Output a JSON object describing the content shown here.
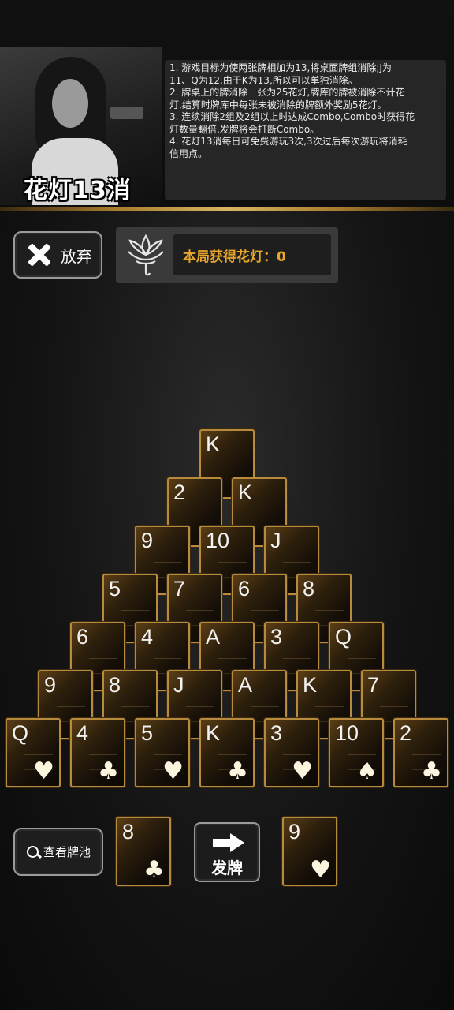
{
  "header": {
    "title": "花灯13消",
    "rules": [
      "1. 游戏目标为使两张牌相加为13,将桌面牌组消除;J为",
      "11、Q为12,由于K为13,所以可以单独消除。",
      "2. 牌桌上的牌消除一张为25花灯,牌库的牌被消除不计花",
      "灯,结算时牌库中每张未被消除的牌额外奖励5花灯。",
      "3. 连续消除2组及2组以上时达成Combo,Combo时获得花",
      "灯数量翻倍,发牌将会打断Combo。",
      "4. 花灯13消每日可免费游玩3次,3次过后每次游玩将消耗",
      "信用点。"
    ]
  },
  "toolbar": {
    "quit_label": "放弃",
    "score_label": "本局获得花灯：0"
  },
  "pyramid": {
    "rows": [
      [
        {
          "v": "K",
          "s": ""
        }
      ],
      [
        {
          "v": "2",
          "s": ""
        },
        {
          "v": "K",
          "s": ""
        }
      ],
      [
        {
          "v": "9",
          "s": ""
        },
        {
          "v": "10",
          "s": ""
        },
        {
          "v": "J",
          "s": ""
        }
      ],
      [
        {
          "v": "5",
          "s": ""
        },
        {
          "v": "7",
          "s": ""
        },
        {
          "v": "6",
          "s": ""
        },
        {
          "v": "8",
          "s": ""
        }
      ],
      [
        {
          "v": "6",
          "s": ""
        },
        {
          "v": "4",
          "s": ""
        },
        {
          "v": "A",
          "s": ""
        },
        {
          "v": "3",
          "s": ""
        },
        {
          "v": "Q",
          "s": ""
        }
      ],
      [
        {
          "v": "9",
          "s": ""
        },
        {
          "v": "8",
          "s": ""
        },
        {
          "v": "J",
          "s": ""
        },
        {
          "v": "A",
          "s": ""
        },
        {
          "v": "K",
          "s": ""
        },
        {
          "v": "7",
          "s": ""
        }
      ],
      [
        {
          "v": "Q",
          "s": "♥"
        },
        {
          "v": "4",
          "s": "♣"
        },
        {
          "v": "5",
          "s": "♥"
        },
        {
          "v": "K",
          "s": "♣"
        },
        {
          "v": "3",
          "s": "♥"
        },
        {
          "v": "10",
          "s": "♠"
        },
        {
          "v": "2",
          "s": "♣"
        }
      ]
    ]
  },
  "bottom": {
    "pool_label": "查看牌池",
    "deal_label": "发牌",
    "stock_card": {
      "v": "8",
      "s": "♣"
    },
    "waste_card": {
      "v": "9",
      "s": "♥"
    }
  },
  "colors": {
    "accent": "#e8a62b",
    "card_border": "#b88a3c"
  }
}
